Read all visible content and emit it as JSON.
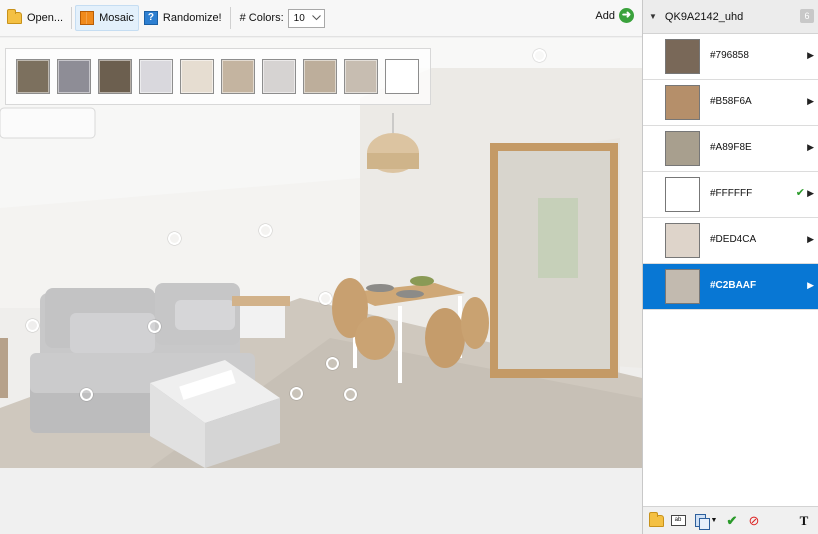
{
  "toolbar": {
    "open_label": "Open...",
    "mosaic_label": "Mosaic",
    "randomize_label": "Randomize!",
    "colors_label": "# Colors:",
    "colors_value": "10",
    "add_label": "Add"
  },
  "palette": {
    "swatches": [
      "#7c705e",
      "#8e8d96",
      "#6c5f4f",
      "#d9d8dd",
      "#e6ddd1",
      "#c4b4a0",
      "#d6d3d2",
      "#bdae9b",
      "#c7bdb1",
      "#ffffff"
    ]
  },
  "right_panel": {
    "title": "QK9A2142_uhd",
    "count": "6",
    "colors": [
      {
        "hex": "#796858",
        "swatch": "#796858",
        "checked": false,
        "selected": false
      },
      {
        "hex": "#B58F6A",
        "swatch": "#B58F6A",
        "checked": false,
        "selected": false
      },
      {
        "hex": "#A89F8E",
        "swatch": "#A89F8E",
        "checked": false,
        "selected": false
      },
      {
        "hex": "#FFFFFF",
        "swatch": "#FFFFFF",
        "checked": true,
        "selected": false
      },
      {
        "hex": "#DED4CA",
        "swatch": "#DED4CA",
        "checked": false,
        "selected": false
      },
      {
        "hex": "#C2BAAF",
        "swatch": "#C2BAAF",
        "checked": false,
        "selected": true
      }
    ]
  },
  "icons": {
    "open": "folder-open-icon",
    "mosaic": "mosaic-icon",
    "randomize": "randomize-icon",
    "add": "add-arrow-icon",
    "footer": [
      "folder-icon",
      "card-icon",
      "copy-icon",
      "check-icon",
      "cancel-icon",
      "text-format-icon"
    ]
  },
  "accent_color": "#0877d4"
}
